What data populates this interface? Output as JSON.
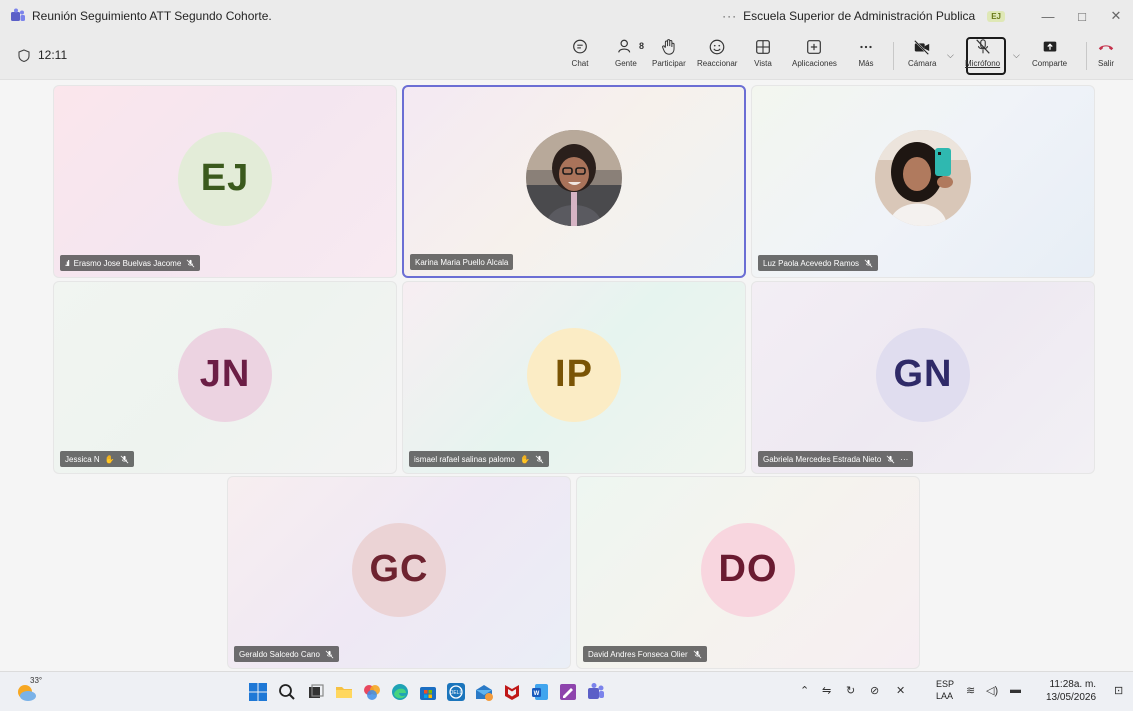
{
  "window": {
    "title": "Reunión Seguimiento ATT Segundo Cohorte.",
    "more": "···",
    "org": "Escuela Superior de Administración Publica",
    "badge": "EJ",
    "minimize": "—",
    "maximize": "□",
    "close": "✕"
  },
  "toolbar": {
    "timer": "12:11",
    "chat": "Chat",
    "people": "Gente",
    "people_count": "8",
    "raise": "Participar",
    "react": "Reaccionar",
    "view": "Vista",
    "apps": "Aplicaciones",
    "more": "Más",
    "camera": "Cámara",
    "mic": "Micrófono",
    "share": "Comparte",
    "leave": "Salir"
  },
  "participants": [
    {
      "initials": "EJ",
      "name": "Erasmo Jose Buelvas Jacome",
      "bg": "#e3ecd8",
      "fg": "#3b5a1d",
      "tile_bg": "linear-gradient(135deg,#fbe6ec,#f4e6f0 50%,#f8eaf1)"
    },
    {
      "initials": "",
      "name": "Karina Maria Puello Alcala",
      "bg": "",
      "fg": "",
      "tile_bg": "linear-gradient(135deg,#f4e9f3,#f6f1ec 50%,#eef3f4)"
    },
    {
      "initials": "",
      "name": "Luz Paola Acevedo Ramos",
      "bg": "",
      "fg": "",
      "tile_bg": "linear-gradient(135deg,#f3f6ef,#f0f3f8 50%,#e7eef6)"
    },
    {
      "initials": "JN",
      "name": "Jessica N",
      "bg": "#ecd3e1",
      "fg": "#6b1e45",
      "tile_bg": "linear-gradient(135deg,#f1f5f1,#eef3ef 50%,#f3f3f3)"
    },
    {
      "initials": "IP",
      "name": "ismael rafael salinas palomo",
      "bg": "#fbecc5",
      "fg": "#7a5405",
      "tile_bg": "linear-gradient(135deg,#f7eef2,#e6f4ef 50%,#f1f5ef)"
    },
    {
      "initials": "GN",
      "name": "Gabriela Mercedes Estrada Nieto",
      "bg": "#e0ddef",
      "fg": "#2f2a68",
      "tile_bg": "linear-gradient(135deg,#f3eef4,#eee9f2 50%,#f2f0f4)"
    },
    {
      "initials": "GC",
      "name": "Geraldo Salcedo Cano",
      "bg": "#ebd3d5",
      "fg": "#6e2330",
      "tile_bg": "linear-gradient(135deg,#f7eef0,#efe8f4 50%,#eaeef6)"
    },
    {
      "initials": "DO",
      "name": "David Andres Fonseca Olier",
      "bg": "#f8d6df",
      "fg": "#6a1b31",
      "tile_bg": "linear-gradient(135deg,#eef6f1,#f5f3ee 50%,#f6eef2)"
    }
  ],
  "taskbar": {
    "temperature": "33°",
    "lang_1": "ESP",
    "lang_2": "LAA",
    "time": "11:28a. m.",
    "date": "13/05/2026"
  },
  "colors": {
    "accent": "#6b6ed4",
    "leave": "#c4314b",
    "teams": "#5b5fc7"
  }
}
